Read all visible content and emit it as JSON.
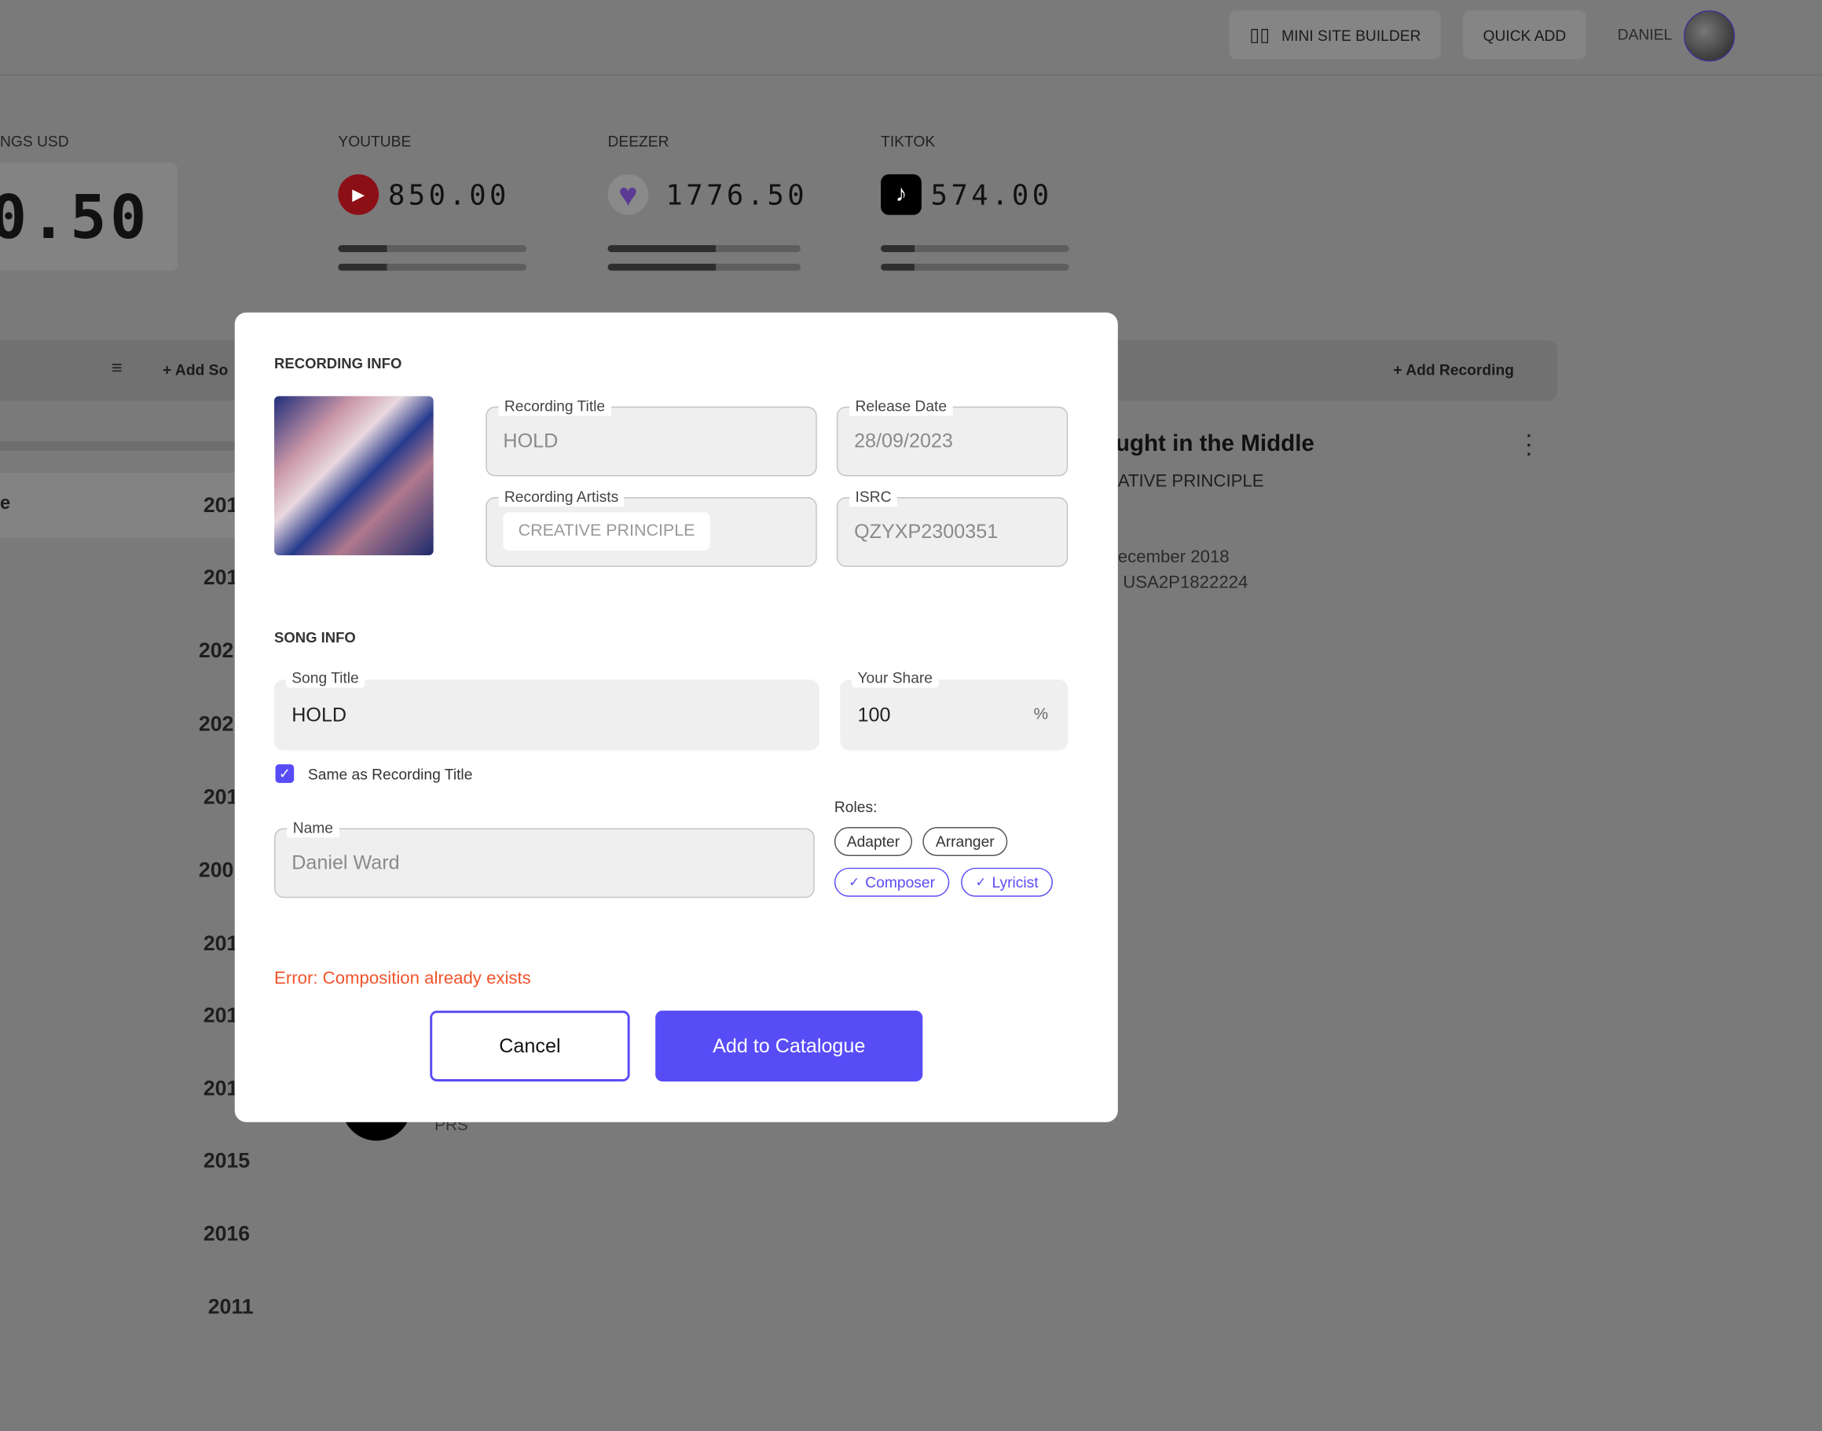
{
  "header": {
    "mini_site_builder": "MINI SITE BUILDER",
    "quick_add": "QUICK ADD",
    "user_name": "DANIEL"
  },
  "stats": {
    "total": {
      "label": "NGS USD",
      "value": "0.50"
    },
    "platforms": [
      {
        "name": "YOUTUBE",
        "value": "850.00",
        "progress": [
          0.26,
          0.26
        ],
        "color": "#c0101a"
      },
      {
        "name": "DEEZER",
        "value": "1776.50",
        "progress": [
          0.56,
          0.56
        ],
        "color": "#7b3fc4"
      },
      {
        "name": "TIKTOK",
        "value": "574.00",
        "progress": [
          0.18,
          0.18
        ],
        "color": "#000000"
      }
    ]
  },
  "toolbar": {
    "add_song": "Add So",
    "add_recording": "Add Recording"
  },
  "list": {
    "first_row": "e",
    "years": [
      "201",
      "201",
      "202",
      "202",
      "201",
      "200",
      "201",
      "201",
      "201",
      "2015",
      "2016",
      "2011"
    ]
  },
  "detail": {
    "title": "ught in the Middle",
    "artist": "ATIVE PRINCIPLE",
    "date": "ecember 2018",
    "isrc": ": USA2P1822224",
    "society": "PRS"
  },
  "modal": {
    "recording_info": "RECORDING INFO",
    "recording_title": {
      "label": "Recording Title",
      "value": "HOLD"
    },
    "release_date": {
      "label": "Release Date",
      "value": "28/09/2023"
    },
    "recording_artists": {
      "label": "Recording Artists",
      "value": "CREATIVE PRINCIPLE"
    },
    "isrc": {
      "label": "ISRC",
      "value": "QZYXP2300351"
    },
    "song_info": "SONG INFO",
    "song_title": {
      "label": "Song Title",
      "value": "HOLD"
    },
    "your_share": {
      "label": "Your Share",
      "value": "100",
      "unit": "%"
    },
    "same_as_recording": {
      "label": "Same as Recording Title",
      "checked": true
    },
    "name": {
      "label": "Name",
      "value": "Daniel Ward"
    },
    "roles_label": "Roles:",
    "roles": [
      {
        "label": "Adapter",
        "selected": false
      },
      {
        "label": "Arranger",
        "selected": false
      },
      {
        "label": "Composer",
        "selected": true,
        "check": "✓"
      },
      {
        "label": "Lyricist",
        "selected": true,
        "check": "✓"
      }
    ],
    "error": "Error: Composition already exists",
    "cancel": "Cancel",
    "submit": "Add to Catalogue",
    "colors": {
      "accent": "#584cf7",
      "error": "#f0532a"
    }
  }
}
